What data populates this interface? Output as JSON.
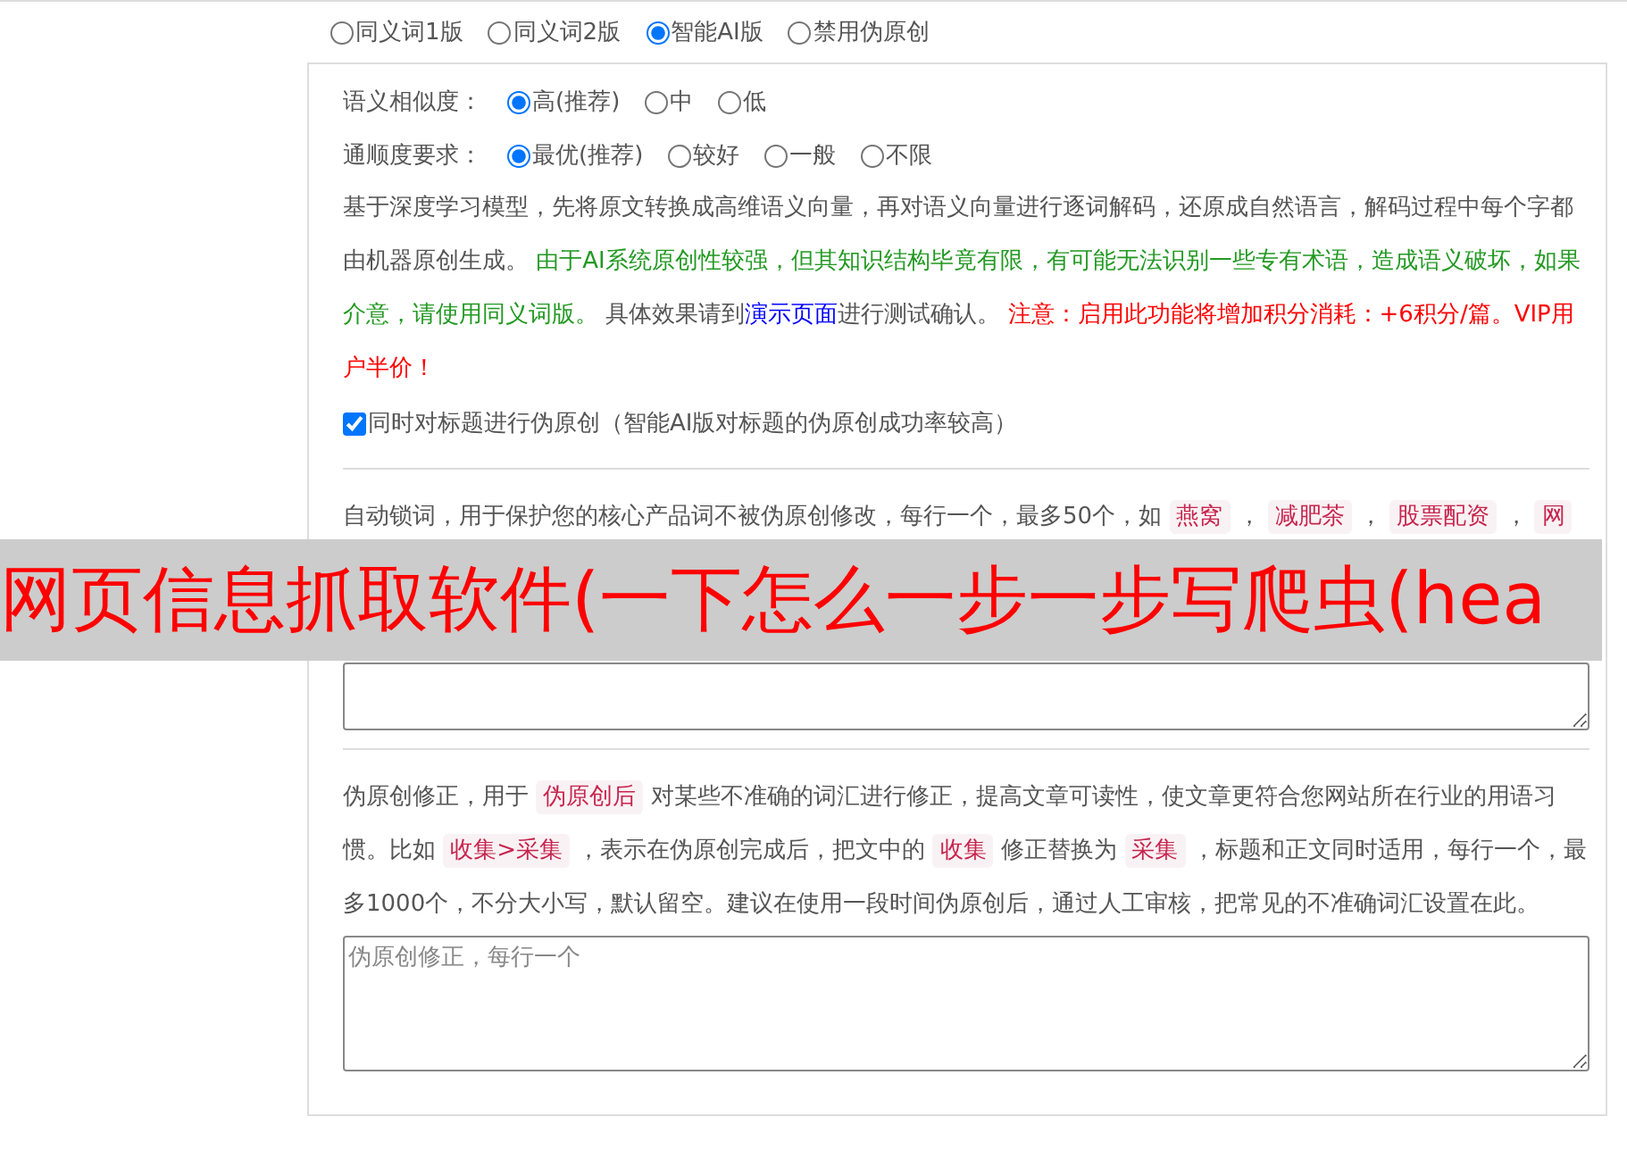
{
  "mode_options": [
    {
      "label": "同义词1版",
      "selected": false
    },
    {
      "label": "同义词2版",
      "selected": false
    },
    {
      "label": "智能AI版",
      "selected": true
    },
    {
      "label": "禁用伪原创",
      "selected": false
    }
  ],
  "similarity": {
    "label": "语义相似度：",
    "options": [
      {
        "label": "高(推荐)",
        "selected": true
      },
      {
        "label": "中",
        "selected": false
      },
      {
        "label": "低",
        "selected": false
      }
    ]
  },
  "fluency": {
    "label": "通顺度要求：",
    "options": [
      {
        "label": "最优(推荐)",
        "selected": true
      },
      {
        "label": "较好",
        "selected": false
      },
      {
        "label": "一般",
        "selected": false
      },
      {
        "label": "不限",
        "selected": false
      }
    ]
  },
  "description": [
    {
      "kind": "plain",
      "text": "基于深度学习模型，先将原文转换成高维语义向量，再对语义向量进行逐词解码，还原成自然语言，解码过程中每个字都由机器原创生成。 "
    },
    {
      "kind": "green",
      "text": "由于AI系统原创性较强，但其知识结构毕竟有限，有可能无法识别一些专有术语，造成语义破坏，如果介意，请使用同义词版。"
    },
    {
      "kind": "plain",
      "text": " 具体效果请到"
    },
    {
      "kind": "link",
      "text": "演示页面"
    },
    {
      "kind": "plain",
      "text": "进行测试确认。 "
    },
    {
      "kind": "red",
      "text": "注意：启用此功能将增加积分消耗：+6积分/篇。VIP用户半价！"
    }
  ],
  "title_checkbox": {
    "label": "同时对标题进行伪原创（智能AI版对标题的伪原创成功率较高）",
    "checked": true
  },
  "lock_words": {
    "description": [
      {
        "kind": "plain",
        "text": "自动锁词，用于保护您的核心产品词不被伪原创修改，每行一个，最多50个，如 "
      },
      {
        "kind": "tag",
        "text": "燕窝"
      },
      {
        "kind": "plain",
        "text": " ， "
      },
      {
        "kind": "tag",
        "text": "减肥茶"
      },
      {
        "kind": "plain",
        "text": " ， "
      },
      {
        "kind": "tag",
        "text": "股票配资"
      },
      {
        "kind": "plain",
        "text": " ， "
      },
      {
        "kind": "tag",
        "text": "网"
      }
    ]
  },
  "correction": {
    "description": [
      {
        "kind": "plain",
        "text": "伪原创修正，用于 "
      },
      {
        "kind": "tag",
        "text": "伪原创后"
      },
      {
        "kind": "plain",
        "text": " 对某些不准确的词汇进行修正，提高文章可读性，使文章更符合您网站所在行业的用语习惯。比如 "
      },
      {
        "kind": "tag",
        "text": "收集>采集"
      },
      {
        "kind": "plain",
        "text": " ，表示在伪原创完成后，把文中的 "
      },
      {
        "kind": "tag",
        "text": "收集"
      },
      {
        "kind": "plain",
        "text": " 修正替换为 "
      },
      {
        "kind": "tag",
        "text": "采集"
      },
      {
        "kind": "plain",
        "text": " ，标题和正文同时适用，每行一个，最多1000个，不分大小写，默认留空。建议在使用一段时间伪原创后，通过人工审核，把常见的不准确词汇设置在此。"
      }
    ],
    "placeholder": "伪原创修正，每行一个"
  },
  "overlay_banner": {
    "text": "网页信息抓取软件(一下怎么一步一步写爬虫(hea"
  }
}
